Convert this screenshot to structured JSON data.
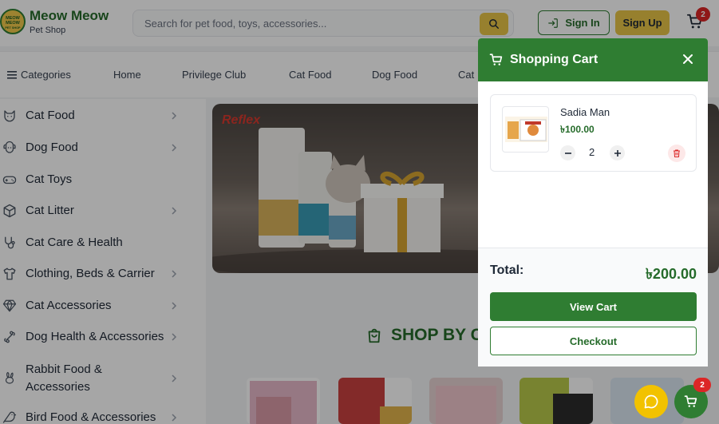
{
  "header": {
    "logo_title": "Meow Meow",
    "logo_subtitle": "Pet Shop",
    "logo_badge_text": "MEOW MEOW PET SHOP",
    "search_placeholder": "Search for pet food, toys, accessories...",
    "signin_label": "Sign In",
    "signup_label": "Sign Up",
    "cart_count": "2"
  },
  "nav": {
    "categories_label": "Categories",
    "items": [
      "Home",
      "Privilege Club",
      "Cat Food",
      "Dog Food",
      "Cat"
    ]
  },
  "sidebar": {
    "items": [
      {
        "label": "Cat Food",
        "icon": "cat-face-icon",
        "has_submenu": true
      },
      {
        "label": "Dog Food",
        "icon": "dog-face-icon",
        "has_submenu": true
      },
      {
        "label": "Cat Toys",
        "icon": "gamepad-icon",
        "has_submenu": false
      },
      {
        "label": "Cat Litter",
        "icon": "box-icon",
        "has_submenu": true
      },
      {
        "label": "Cat Care & Health",
        "icon": "stethoscope-icon",
        "has_submenu": false
      },
      {
        "label": "Clothing, Beds & Carrier",
        "icon": "shirt-icon",
        "has_submenu": true
      },
      {
        "label": "Cat Accessories",
        "icon": "gem-icon",
        "has_submenu": true
      },
      {
        "label": "Dog Health & Accessories",
        "icon": "bone-icon",
        "has_submenu": true
      },
      {
        "label": "Rabbit Food & Accessories",
        "icon": "rabbit-icon",
        "has_submenu": true
      },
      {
        "label": "Bird Food & Accessories",
        "icon": "bird-icon",
        "has_submenu": true
      }
    ]
  },
  "banner": {
    "brand": "Reflex"
  },
  "shop_by_category": {
    "heading": "SHOP BY C"
  },
  "cart": {
    "title": "Shopping Cart",
    "item": {
      "name": "Sadia Man",
      "price": "৳100.00",
      "quantity": "2"
    },
    "total_label": "Total:",
    "total_value": "৳200.00",
    "view_cart_label": "View Cart",
    "checkout_label": "Checkout"
  },
  "floating": {
    "cart_count": "2"
  },
  "colors": {
    "brand_green": "#2f7d32",
    "accent_yellow": "#e8c547",
    "badge_red": "#dc2626"
  }
}
